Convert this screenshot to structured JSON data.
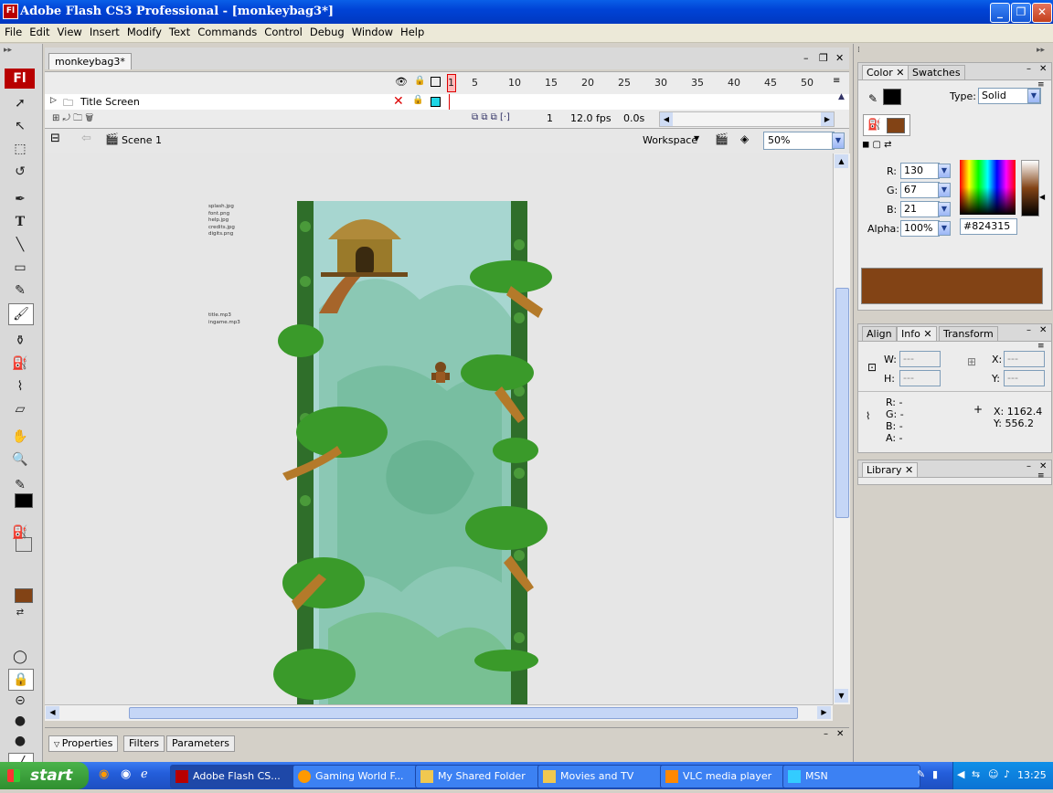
{
  "window": {
    "title": "Adobe Flash CS3 Professional - [monkeybag3*]",
    "app_icon": "Fl",
    "minimize": "_",
    "maximize": "❐",
    "close": "✕"
  },
  "menu": [
    "File",
    "Edit",
    "View",
    "Insert",
    "Modify",
    "Text",
    "Commands",
    "Control",
    "Debug",
    "Window",
    "Help"
  ],
  "tools": {
    "logo": "Fl",
    "fill_color": "#000000",
    "fill_color2": "#824315"
  },
  "document": {
    "tab": "monkeybag3*",
    "layer_name": "Title Screen",
    "frame_ticks": [
      "1",
      "5",
      "10",
      "15",
      "20",
      "25",
      "30",
      "35",
      "40",
      "45",
      "50"
    ],
    "current_frame": "1",
    "fps": "12.0 fps",
    "elapsed": "0.0s",
    "scene": "Scene 1",
    "workspace": "Workspace",
    "zoom": "50%",
    "asset_notes_images": [
      "splash.jpg",
      "font.png",
      "help.jpg",
      "credits.jpg",
      "digits.png"
    ],
    "asset_notes_sounds": [
      "title.mp3",
      "ingame.mp3"
    ]
  },
  "properties_panel": {
    "tabs": [
      "Properties",
      "Filters",
      "Parameters"
    ]
  },
  "color_panel": {
    "tabs": [
      "Color",
      "Swatches"
    ],
    "type_label": "Type:",
    "type_value": "Solid",
    "r_label": "R:",
    "r": "130",
    "g_label": "G:",
    "g": "67",
    "b_label": "B:",
    "b": "21",
    "alpha_label": "Alpha:",
    "alpha": "100%",
    "hex": "#824315",
    "swatch_color": "#824315"
  },
  "info_panel": {
    "tabs": [
      "Align",
      "Info",
      "Transform"
    ],
    "w_label": "W:",
    "w": "---",
    "h_label": "H:",
    "h": "---",
    "x_label": "X:",
    "x": "---",
    "y_label": "Y:",
    "y": "---",
    "r_line": "R: -",
    "g_line": "G: -",
    "b_line": "B: -",
    "a_line": "A: -",
    "cursor_x": "X:  1162.4",
    "cursor_y": "Y:  556.2"
  },
  "library_panel": {
    "tabs": [
      "Library"
    ]
  },
  "taskbar": {
    "start": "start",
    "tasks": [
      "Adobe Flash CS...",
      "Gaming World F...",
      "My Shared Folder",
      "Movies and TV",
      "VLC media player",
      "MSN"
    ],
    "clock": "13:25"
  }
}
